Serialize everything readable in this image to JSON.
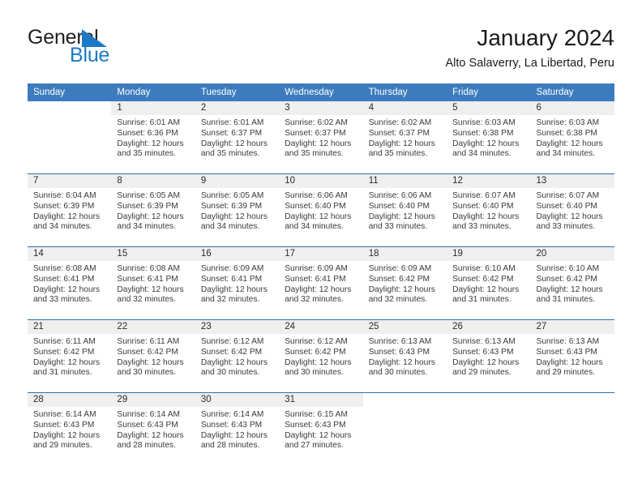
{
  "brand": {
    "name_part1": "General",
    "name_part2": "Blue",
    "triangle_icon": "triangle-icon",
    "color_dark": "#231f20",
    "color_blue": "#1a7ac4"
  },
  "header": {
    "month_title": "January 2024",
    "location": "Alto Salaverry, La Libertad, Peru"
  },
  "colors": {
    "header_blue": "#3c7cbe",
    "week_divider_blue": "#2d6ca8",
    "daynum_strip_gray": "#efefef",
    "text_dark": "#1a1a1a",
    "text_body": "#3a3a3a"
  },
  "weekdays": [
    "Sunday",
    "Monday",
    "Tuesday",
    "Wednesday",
    "Thursday",
    "Friday",
    "Saturday"
  ],
  "weeks": [
    {
      "days": [
        {
          "date": "",
          "empty": true,
          "lines": []
        },
        {
          "date": "1",
          "empty": false,
          "lines": [
            "Sunrise: 6:01 AM",
            "Sunset: 6:36 PM",
            "Daylight: 12 hours",
            "and 35 minutes."
          ]
        },
        {
          "date": "2",
          "empty": false,
          "lines": [
            "Sunrise: 6:01 AM",
            "Sunset: 6:37 PM",
            "Daylight: 12 hours",
            "and 35 minutes."
          ]
        },
        {
          "date": "3",
          "empty": false,
          "lines": [
            "Sunrise: 6:02 AM",
            "Sunset: 6:37 PM",
            "Daylight: 12 hours",
            "and 35 minutes."
          ]
        },
        {
          "date": "4",
          "empty": false,
          "lines": [
            "Sunrise: 6:02 AM",
            "Sunset: 6:37 PM",
            "Daylight: 12 hours",
            "and 35 minutes."
          ]
        },
        {
          "date": "5",
          "empty": false,
          "lines": [
            "Sunrise: 6:03 AM",
            "Sunset: 6:38 PM",
            "Daylight: 12 hours",
            "and 34 minutes."
          ]
        },
        {
          "date": "6",
          "empty": false,
          "lines": [
            "Sunrise: 6:03 AM",
            "Sunset: 6:38 PM",
            "Daylight: 12 hours",
            "and 34 minutes."
          ]
        }
      ]
    },
    {
      "days": [
        {
          "date": "7",
          "empty": false,
          "lines": [
            "Sunrise: 6:04 AM",
            "Sunset: 6:39 PM",
            "Daylight: 12 hours",
            "and 34 minutes."
          ]
        },
        {
          "date": "8",
          "empty": false,
          "lines": [
            "Sunrise: 6:05 AM",
            "Sunset: 6:39 PM",
            "Daylight: 12 hours",
            "and 34 minutes."
          ]
        },
        {
          "date": "9",
          "empty": false,
          "lines": [
            "Sunrise: 6:05 AM",
            "Sunset: 6:39 PM",
            "Daylight: 12 hours",
            "and 34 minutes."
          ]
        },
        {
          "date": "10",
          "empty": false,
          "lines": [
            "Sunrise: 6:06 AM",
            "Sunset: 6:40 PM",
            "Daylight: 12 hours",
            "and 34 minutes."
          ]
        },
        {
          "date": "11",
          "empty": false,
          "lines": [
            "Sunrise: 6:06 AM",
            "Sunset: 6:40 PM",
            "Daylight: 12 hours",
            "and 33 minutes."
          ]
        },
        {
          "date": "12",
          "empty": false,
          "lines": [
            "Sunrise: 6:07 AM",
            "Sunset: 6:40 PM",
            "Daylight: 12 hours",
            "and 33 minutes."
          ]
        },
        {
          "date": "13",
          "empty": false,
          "lines": [
            "Sunrise: 6:07 AM",
            "Sunset: 6:40 PM",
            "Daylight: 12 hours",
            "and 33 minutes."
          ]
        }
      ]
    },
    {
      "days": [
        {
          "date": "14",
          "empty": false,
          "lines": [
            "Sunrise: 6:08 AM",
            "Sunset: 6:41 PM",
            "Daylight: 12 hours",
            "and 33 minutes."
          ]
        },
        {
          "date": "15",
          "empty": false,
          "lines": [
            "Sunrise: 6:08 AM",
            "Sunset: 6:41 PM",
            "Daylight: 12 hours",
            "and 32 minutes."
          ]
        },
        {
          "date": "16",
          "empty": false,
          "lines": [
            "Sunrise: 6:09 AM",
            "Sunset: 6:41 PM",
            "Daylight: 12 hours",
            "and 32 minutes."
          ]
        },
        {
          "date": "17",
          "empty": false,
          "lines": [
            "Sunrise: 6:09 AM",
            "Sunset: 6:41 PM",
            "Daylight: 12 hours",
            "and 32 minutes."
          ]
        },
        {
          "date": "18",
          "empty": false,
          "lines": [
            "Sunrise: 6:09 AM",
            "Sunset: 6:42 PM",
            "Daylight: 12 hours",
            "and 32 minutes."
          ]
        },
        {
          "date": "19",
          "empty": false,
          "lines": [
            "Sunrise: 6:10 AM",
            "Sunset: 6:42 PM",
            "Daylight: 12 hours",
            "and 31 minutes."
          ]
        },
        {
          "date": "20",
          "empty": false,
          "lines": [
            "Sunrise: 6:10 AM",
            "Sunset: 6:42 PM",
            "Daylight: 12 hours",
            "and 31 minutes."
          ]
        }
      ]
    },
    {
      "days": [
        {
          "date": "21",
          "empty": false,
          "lines": [
            "Sunrise: 6:11 AM",
            "Sunset: 6:42 PM",
            "Daylight: 12 hours",
            "and 31 minutes."
          ]
        },
        {
          "date": "22",
          "empty": false,
          "lines": [
            "Sunrise: 6:11 AM",
            "Sunset: 6:42 PM",
            "Daylight: 12 hours",
            "and 30 minutes."
          ]
        },
        {
          "date": "23",
          "empty": false,
          "lines": [
            "Sunrise: 6:12 AM",
            "Sunset: 6:42 PM",
            "Daylight: 12 hours",
            "and 30 minutes."
          ]
        },
        {
          "date": "24",
          "empty": false,
          "lines": [
            "Sunrise: 6:12 AM",
            "Sunset: 6:42 PM",
            "Daylight: 12 hours",
            "and 30 minutes."
          ]
        },
        {
          "date": "25",
          "empty": false,
          "lines": [
            "Sunrise: 6:13 AM",
            "Sunset: 6:43 PM",
            "Daylight: 12 hours",
            "and 30 minutes."
          ]
        },
        {
          "date": "26",
          "empty": false,
          "lines": [
            "Sunrise: 6:13 AM",
            "Sunset: 6:43 PM",
            "Daylight: 12 hours",
            "and 29 minutes."
          ]
        },
        {
          "date": "27",
          "empty": false,
          "lines": [
            "Sunrise: 6:13 AM",
            "Sunset: 6:43 PM",
            "Daylight: 12 hours",
            "and 29 minutes."
          ]
        }
      ]
    },
    {
      "days": [
        {
          "date": "28",
          "empty": false,
          "lines": [
            "Sunrise: 6:14 AM",
            "Sunset: 6:43 PM",
            "Daylight: 12 hours",
            "and 29 minutes."
          ]
        },
        {
          "date": "29",
          "empty": false,
          "lines": [
            "Sunrise: 6:14 AM",
            "Sunset: 6:43 PM",
            "Daylight: 12 hours",
            "and 28 minutes."
          ]
        },
        {
          "date": "30",
          "empty": false,
          "lines": [
            "Sunrise: 6:14 AM",
            "Sunset: 6:43 PM",
            "Daylight: 12 hours",
            "and 28 minutes."
          ]
        },
        {
          "date": "31",
          "empty": false,
          "lines": [
            "Sunrise: 6:15 AM",
            "Sunset: 6:43 PM",
            "Daylight: 12 hours",
            "and 27 minutes."
          ]
        },
        {
          "date": "",
          "empty": true,
          "lines": []
        },
        {
          "date": "",
          "empty": true,
          "lines": []
        },
        {
          "date": "",
          "empty": true,
          "lines": []
        }
      ]
    }
  ]
}
